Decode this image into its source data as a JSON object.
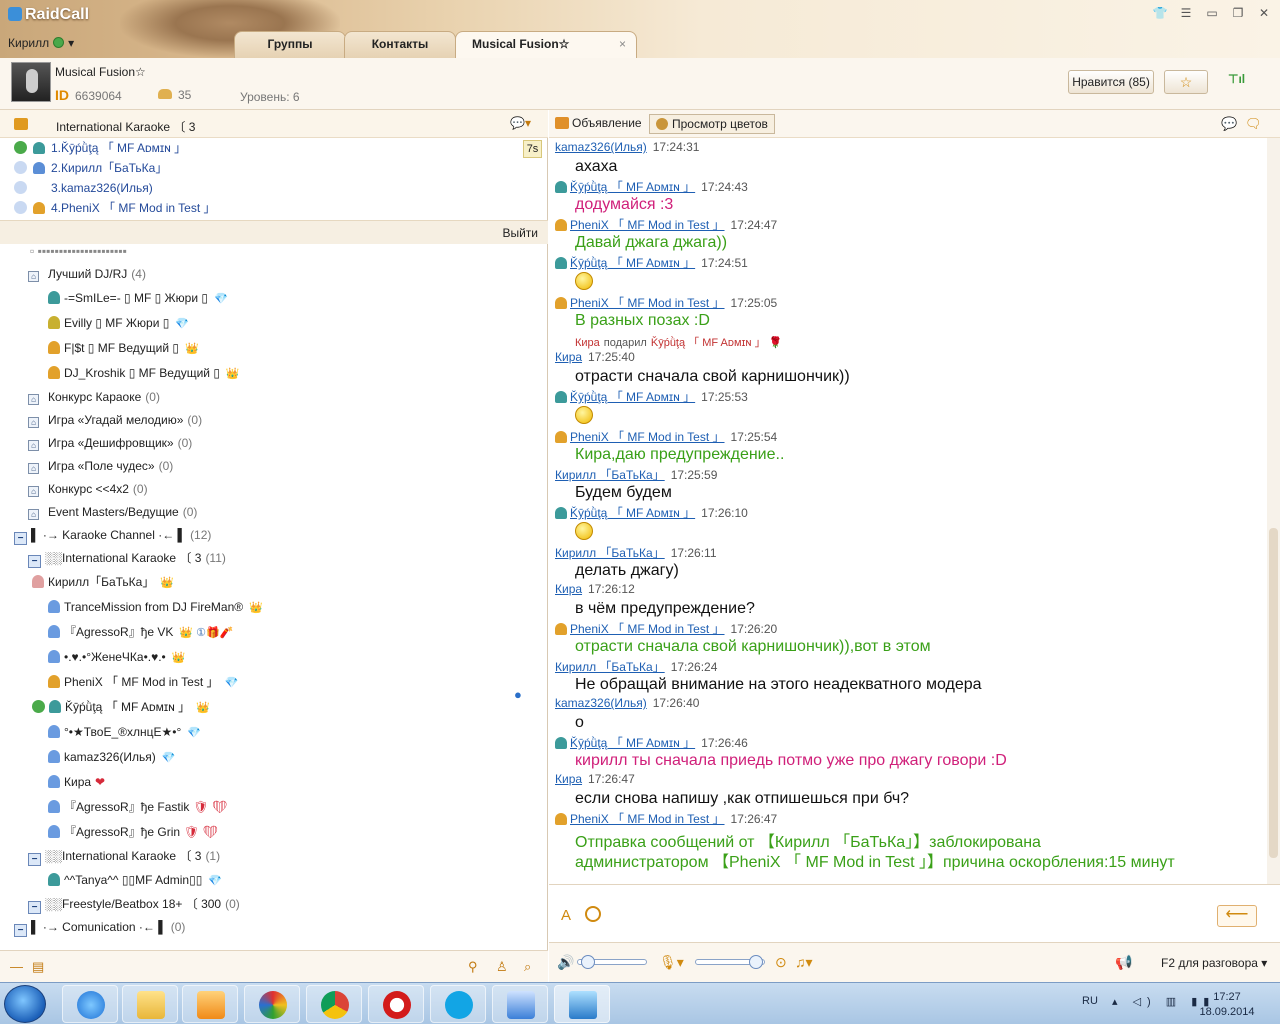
{
  "app": {
    "logo_text": "RaidCall",
    "user_name": "Кирилл",
    "tabs": [
      "Группы",
      "Контакты",
      "Musical Fusion☆"
    ],
    "tab_close": "×",
    "window_controls": [
      "shirt-icon",
      "list-icon",
      "minimize-icon",
      "restore-icon",
      "close-icon"
    ]
  },
  "room": {
    "name": "Musical Fusion☆",
    "id_label": "ID",
    "id": "6639064",
    "members": "35",
    "level": "Уровень: 6",
    "like_button": "Нравится (85)",
    "fav_icon": "☆"
  },
  "queue": {
    "header": "International Karaoke 〔 3",
    "items": [
      {
        "label": "1.Ǩȳṕǜţą 「 MF Aᴅᴍɪɴ 」",
        "icon": "speaker"
      },
      {
        "label": "2.Кирилл「БаТьКа」",
        "icon": "user-blue"
      },
      {
        "label": "3.kamaz326(Илья)",
        "icon": "none"
      },
      {
        "label": "4.PheniX 「 MF Mod in Test 」",
        "icon": "user-orange"
      }
    ],
    "timer": "7s",
    "exit": "Выйти"
  },
  "tree": [
    {
      "label": "Лучший DJ/RJ",
      "count": "(4)",
      "type": "channel"
    },
    {
      "label": "-=SmILe=- ▯ MF ▯ Жюри ▯",
      "type": "user-teal",
      "badge": "💎"
    },
    {
      "label": "Evilly ▯ MF Жюри ▯",
      "type": "user-gold",
      "badge": "💎"
    },
    {
      "label": "F|$t ▯ MF Ведущий ▯",
      "type": "user-or",
      "badge": "👑"
    },
    {
      "label": "DJ_Kroshik ▯ MF Ведущий ▯",
      "type": "user-or",
      "badge": "👑"
    },
    {
      "label": "Конкурс Караоке",
      "count": "(0)",
      "type": "channel"
    },
    {
      "label": "Игра «Угадай мелодию»",
      "count": "(0)",
      "type": "channel"
    },
    {
      "label": "Игра «Дешифровщик»",
      "count": "(0)",
      "type": "channel"
    },
    {
      "label": "Игра «Поле чудес»",
      "count": "(0)",
      "type": "channel"
    },
    {
      "label": "Конкурс <<4x2",
      "count": "(0)",
      "type": "channel"
    },
    {
      "label": "Event Masters/Ведущие",
      "count": "(0)",
      "type": "channel"
    },
    {
      "label": "▌ ·→ Karaoke Channel ·←  ▌",
      "count": "(12)",
      "type": "group"
    },
    {
      "label": "░░International Karaoke 〔 3",
      "count": "(11)",
      "type": "subgroup"
    },
    {
      "label": "Кирилл「БаТьКа」",
      "type": "user-red",
      "badge": "👑"
    },
    {
      "label": "TranceMission from DJ FireMan®",
      "type": "user-blue",
      "badge": "👑"
    },
    {
      "label": "『AgressoR』ђe VK",
      "type": "user-blue",
      "badge": "👑 ①🎁🧨"
    },
    {
      "label": "•.♥.•°ЖенеЧКа•.♥.•",
      "type": "user-blue",
      "badge": "👑"
    },
    {
      "label": "PheniX 「 MF Mod in Test 」",
      "type": "user-or",
      "badge": "💎"
    },
    {
      "label": "Ǩȳṕǜţą 「 MF Aᴅᴍɪɴ 」",
      "type": "user-teal-spk",
      "badge": "👑"
    },
    {
      "label": "°•★ТвоЕ_®хлнцЕ★•°",
      "type": "user-blue",
      "badge": "💎"
    },
    {
      "label": "kamaz326(Илья)",
      "type": "user-blue",
      "badge": "💎"
    },
    {
      "label": "Кира",
      "type": "user-blue",
      "badge": "❤"
    },
    {
      "label": "『AgressoR』ђe Fastik",
      "type": "user-blue",
      "badge": "🛡 ❤"
    },
    {
      "label": "『AgressoR』ђe Grin",
      "type": "user-blue",
      "badge": "🛡 ❤"
    },
    {
      "label": "░░International Karaoke 〔 3",
      "count": "(1)",
      "type": "subgroup"
    },
    {
      "label": "^^Tanya^^ ▯▯MF Admin▯▯",
      "type": "user-teal",
      "badge": "💎"
    },
    {
      "label": "░░Freestyle/Beatbox 18+ 〔 300",
      "count": "(0)",
      "type": "subgroup"
    },
    {
      "label": "▌ ·→ Comunication ·←  ▌",
      "count": "(0)",
      "type": "group"
    }
  ],
  "chat_tools": {
    "announce": "Объявление",
    "flowers": "Просмотр цветов"
  },
  "chat": [
    {
      "kind": "hdr",
      "name": "kamaz326(Илья)",
      "time": "17:24:31",
      "icon": "none"
    },
    {
      "kind": "msg",
      "text": "ахаха",
      "color": "black"
    },
    {
      "kind": "hdr",
      "name": "Ǩȳṕǜţą 「 MF Aᴅᴍɪɴ 」",
      "time": "17:24:43",
      "icon": "teal"
    },
    {
      "kind": "msg",
      "text": "додумайся :3",
      "color": "pink"
    },
    {
      "kind": "hdr",
      "name": "PheniX 「 MF Mod in Test 」",
      "time": "17:24:47",
      "icon": "or"
    },
    {
      "kind": "msg",
      "text": "Давай джага джага))",
      "color": "green"
    },
    {
      "kind": "hdr",
      "name": "Ǩȳṕǜţą 「 MF Aᴅᴍɪɴ 」",
      "time": "17:24:51",
      "icon": "teal"
    },
    {
      "kind": "emo"
    },
    {
      "kind": "hdr",
      "name": "PheniX 「 MF Mod in Test 」",
      "time": "17:25:05",
      "icon": "or"
    },
    {
      "kind": "msg",
      "text": "В разных позах :D",
      "color": "green"
    },
    {
      "kind": "gift",
      "from": "Кира",
      "verb": "подарил",
      "to": "Ǩȳṕǜţą 「 MF Aᴅᴍɪɴ 」"
    },
    {
      "kind": "hdr",
      "name": "Кира",
      "time": "17:25:40",
      "icon": "none"
    },
    {
      "kind": "msg",
      "text": "отрасти сначала свой карнишончик))",
      "color": "black"
    },
    {
      "kind": "hdr",
      "name": "Ǩȳṕǜţą 「 MF Aᴅᴍɪɴ 」",
      "time": "17:25:53",
      "icon": "teal"
    },
    {
      "kind": "emo"
    },
    {
      "kind": "hdr",
      "name": "PheniX 「 MF Mod in Test 」",
      "time": "17:25:54",
      "icon": "or"
    },
    {
      "kind": "msg",
      "text": "Кира,даю предупреждение..",
      "color": "green"
    },
    {
      "kind": "hdr",
      "name": "Кирилл 「БаТьКа」",
      "time": "17:25:59",
      "icon": "none"
    },
    {
      "kind": "msg",
      "text": "Будем будем",
      "color": "black"
    },
    {
      "kind": "hdr",
      "name": "Ǩȳṕǜţą 「 MF Aᴅᴍɪɴ 」",
      "time": "17:26:10",
      "icon": "teal"
    },
    {
      "kind": "emo"
    },
    {
      "kind": "hdr",
      "name": "Кирилл 「БаТьКа」",
      "time": "17:26:11",
      "icon": "none"
    },
    {
      "kind": "msg",
      "text": "делать джагу)",
      "color": "black"
    },
    {
      "kind": "hdr",
      "name": "Кира",
      "time": "17:26:12",
      "icon": "none"
    },
    {
      "kind": "msg",
      "text": "в чём предупреждение?",
      "color": "black"
    },
    {
      "kind": "hdr",
      "name": "PheniX 「 MF Mod in Test 」",
      "time": "17:26:20",
      "icon": "or"
    },
    {
      "kind": "msg",
      "text": "отрасти сначала свой карнишончик)),вот в этом",
      "color": "green"
    },
    {
      "kind": "hdr",
      "name": "Кирилл 「БаТьКа」",
      "time": "17:26:24",
      "icon": "none"
    },
    {
      "kind": "msg",
      "text": "Не обращай внимание на этого неадекватного модера",
      "color": "black"
    },
    {
      "kind": "hdr",
      "name": "kamaz326(Илья)",
      "time": "17:26:40",
      "icon": "none"
    },
    {
      "kind": "msg",
      "text": "о",
      "color": "black"
    },
    {
      "kind": "hdr",
      "name": "Ǩȳṕǜţą 「 MF Aᴅᴍɪɴ 」",
      "time": "17:26:46",
      "icon": "teal"
    },
    {
      "kind": "msg",
      "text": "кирилл ты сначала приедь потмо уже про джагу говори :D",
      "color": "pink"
    },
    {
      "kind": "hdr",
      "name": "Кира",
      "time": "17:26:47",
      "icon": "none"
    },
    {
      "kind": "msg",
      "text": "если снова напишу ,как отпишешься при бч?",
      "color": "black"
    },
    {
      "kind": "hdr",
      "name": "PheniX 「 MF Mod in Test 」",
      "time": "17:26:47",
      "icon": "or"
    },
    {
      "kind": "msg",
      "text": "Отправка сообщений от 【Кирилл 「БаТьКа」】заблокирована",
      "color": "green"
    },
    {
      "kind": "msg",
      "text": "администратором 【PheniX 「 MF Mod in Test 」】причина оскорбления:15 минут",
      "color": "green"
    }
  ],
  "input": {
    "placeholder": "",
    "send_icon": "⟵"
  },
  "voice": {
    "volume_level": 0.05,
    "mic_level": 0.95,
    "push_to_talk": "F2 для разговора"
  },
  "taskbar": {
    "lang": "RU",
    "time": "17:27",
    "date": "18.09.2014"
  },
  "colors": {
    "accent": "#d08a10",
    "chat_pink": "#d0207a",
    "chat_green": "#3aa018",
    "link_blue": "#1e5fb3"
  }
}
